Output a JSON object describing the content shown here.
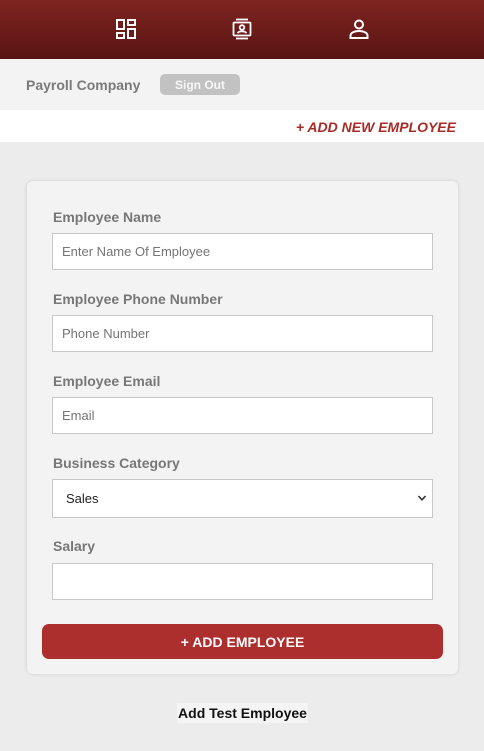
{
  "nav": {
    "items": [
      {
        "icon": "dashboard-icon"
      },
      {
        "icon": "contacts-icon"
      },
      {
        "icon": "profile-icon"
      }
    ]
  },
  "company": {
    "name": "Payroll Company",
    "sign_out_label": "Sign Out"
  },
  "actions": {
    "add_new_label": "+ ADD NEW EMPLOYEE"
  },
  "form": {
    "name": {
      "label": "Employee Name",
      "placeholder": "Enter Name Of Employee",
      "value": ""
    },
    "phone": {
      "label": "Employee Phone Number",
      "placeholder": "Phone Number",
      "value": ""
    },
    "email": {
      "label": "Employee Email",
      "placeholder": "Email",
      "value": ""
    },
    "category": {
      "label": "Business Category",
      "selected": "Sales"
    },
    "salary": {
      "label": "Salary",
      "placeholder": "",
      "value": ""
    },
    "submit_label": "+ ADD EMPLOYEE"
  },
  "test": {
    "add_test_label": "Add Test Employee"
  },
  "colors": {
    "brand": "#7e2420",
    "accent": "#ad2f2d",
    "link": "#a82b27",
    "background": "#ececec"
  }
}
